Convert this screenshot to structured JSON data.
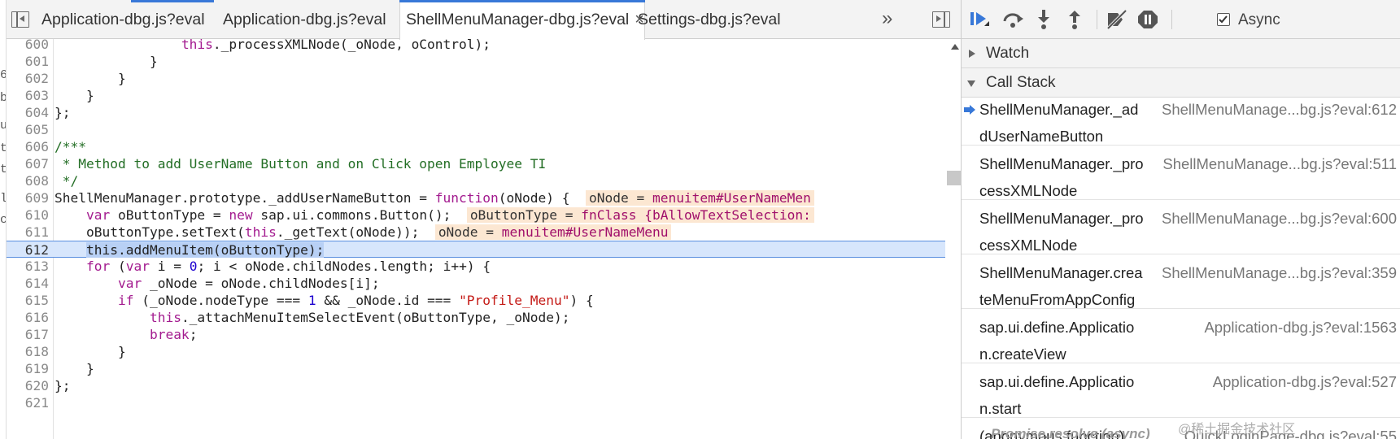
{
  "left_edge": [
    "6",
    "b",
    "u",
    "t",
    "t",
    "l",
    "c"
  ],
  "editor": {
    "tabs": [
      {
        "label": "Application-dbg.js?eval",
        "active": false
      },
      {
        "label": "Application-dbg.js?eval",
        "active": false
      },
      {
        "label": "ShellMenuManager-dbg.js?eval",
        "active": true,
        "close": "×"
      },
      {
        "label": "Settings-dbg.js?eval",
        "active": false
      }
    ],
    "more_tabs": "»",
    "current_line": "612"
  },
  "code_lines": [
    {
      "n": "600",
      "indent": "                ",
      "parts": [
        {
          "t": "kw",
          "v": "this"
        },
        {
          "t": "p",
          "v": "._processXMLNode(_oNode, oControl);"
        }
      ]
    },
    {
      "n": "601",
      "indent": "            ",
      "parts": [
        {
          "t": "p",
          "v": "}"
        }
      ]
    },
    {
      "n": "602",
      "indent": "        ",
      "parts": [
        {
          "t": "p",
          "v": "}"
        }
      ]
    },
    {
      "n": "603",
      "indent": "    ",
      "parts": [
        {
          "t": "p",
          "v": "}"
        }
      ]
    },
    {
      "n": "604",
      "indent": "",
      "parts": [
        {
          "t": "p",
          "v": "};"
        }
      ]
    },
    {
      "n": "605",
      "indent": "",
      "parts": []
    },
    {
      "n": "606",
      "indent": "",
      "parts": [
        {
          "t": "cmt",
          "v": "/***"
        }
      ]
    },
    {
      "n": "607",
      "indent": "",
      "parts": [
        {
          "t": "cmt",
          "v": " * Method to add UserName Button and on Click open Employee TI"
        }
      ]
    },
    {
      "n": "608",
      "indent": "",
      "parts": [
        {
          "t": "cmt",
          "v": " */"
        }
      ]
    },
    {
      "n": "609",
      "indent": "",
      "parts": [
        {
          "t": "p",
          "v": "ShellMenuManager.prototype._addUserNameButton = "
        },
        {
          "t": "kw",
          "v": "function"
        },
        {
          "t": "p",
          "v": "(oNode) {  "
        },
        {
          "t": "inl",
          "name": "oNode",
          "val": "menuitem#UserNameMen"
        }
      ]
    },
    {
      "n": "610",
      "indent": "    ",
      "parts": [
        {
          "t": "kw",
          "v": "var"
        },
        {
          "t": "p",
          "v": " oButtonType = "
        },
        {
          "t": "kw",
          "v": "new"
        },
        {
          "t": "p",
          "v": " sap.ui.commons.Button();  "
        },
        {
          "t": "inl",
          "name": "oButtonType",
          "val": "fnClass {bAllowTextSelection:"
        }
      ]
    },
    {
      "n": "611",
      "indent": "    ",
      "parts": [
        {
          "t": "p",
          "v": "oButtonType.setText("
        },
        {
          "t": "kw",
          "v": "this"
        },
        {
          "t": "p",
          "v": "._getText(oNode));  "
        },
        {
          "t": "inl",
          "name": "oNode",
          "val": "menuitem#UserNameMenu"
        }
      ]
    },
    {
      "n": "612",
      "indent": "    ",
      "parts": [
        {
          "t": "sel",
          "v": "this.addMenuItem(oButtonType);"
        }
      ]
    },
    {
      "n": "613",
      "indent": "    ",
      "parts": [
        {
          "t": "kw",
          "v": "for"
        },
        {
          "t": "p",
          "v": " ("
        },
        {
          "t": "kw",
          "v": "var"
        },
        {
          "t": "p",
          "v": " i = "
        },
        {
          "t": "num",
          "v": "0"
        },
        {
          "t": "p",
          "v": "; i < oNode.childNodes.length; i++) {"
        }
      ]
    },
    {
      "n": "614",
      "indent": "        ",
      "parts": [
        {
          "t": "kw",
          "v": "var"
        },
        {
          "t": "p",
          "v": " _oNode = oNode.childNodes[i];"
        }
      ]
    },
    {
      "n": "615",
      "indent": "        ",
      "parts": [
        {
          "t": "kw",
          "v": "if"
        },
        {
          "t": "p",
          "v": " (_oNode.nodeType === "
        },
        {
          "t": "num",
          "v": "1"
        },
        {
          "t": "p",
          "v": " && _oNode.id === "
        },
        {
          "t": "str",
          "v": "\"Profile_Menu\""
        },
        {
          "t": "p",
          "v": ") {"
        }
      ]
    },
    {
      "n": "616",
      "indent": "            ",
      "parts": [
        {
          "t": "kw",
          "v": "this"
        },
        {
          "t": "p",
          "v": "._attachMenuItemSelectEvent(oButtonType, _oNode);"
        }
      ]
    },
    {
      "n": "617",
      "indent": "            ",
      "parts": [
        {
          "t": "kw",
          "v": "break"
        },
        {
          "t": "p",
          "v": ";"
        }
      ]
    },
    {
      "n": "618",
      "indent": "        ",
      "parts": [
        {
          "t": "p",
          "v": "}"
        }
      ]
    },
    {
      "n": "619",
      "indent": "    ",
      "parts": [
        {
          "t": "p",
          "v": "}"
        }
      ]
    },
    {
      "n": "620",
      "indent": "",
      "parts": [
        {
          "t": "p",
          "v": "};"
        }
      ]
    },
    {
      "n": "621",
      "indent": "",
      "parts": []
    }
  ],
  "sidebar": {
    "async_label": "Async",
    "async_checked": true,
    "watch_label": "Watch",
    "callstack_label": "Call Stack",
    "frames": [
      {
        "fn": "ShellMenuManager._addUserNameButton",
        "loc": "ShellMenuManage...bg.js?eval:612",
        "current": true
      },
      {
        "fn": "ShellMenuManager._processXMLNode",
        "loc": "ShellMenuManage...bg.js?eval:511",
        "current": false
      },
      {
        "fn": "ShellMenuManager._processXMLNode",
        "loc": "ShellMenuManage...bg.js?eval:600",
        "current": false
      },
      {
        "fn": "ShellMenuManager.createMenuFromAppConfig",
        "loc": "ShellMenuManage...bg.js?eval:359",
        "current": false
      },
      {
        "fn": "sap.ui.define.Application.createView",
        "loc": "Application-dbg.js?eval:1563",
        "current": false
      },
      {
        "fn": "sap.ui.define.Application.start",
        "loc": "Application-dbg.js?eval:527",
        "current": false
      },
      {
        "fn": "(anonymous function)",
        "loc": "QuickLoginPage-dbg.js?eval:55",
        "current": false
      }
    ],
    "promise_row": "Promise.resolve (async)"
  },
  "watermark": "@稀土掘金技术社区",
  "colors": {
    "accent": "#3878d8",
    "keyword": "#a31b8f",
    "string": "#c41a16",
    "number": "#1c00cf",
    "comment": "#236e25",
    "exec_line": "#d7e6fc",
    "inline_value_bg": "#fce7d2"
  }
}
